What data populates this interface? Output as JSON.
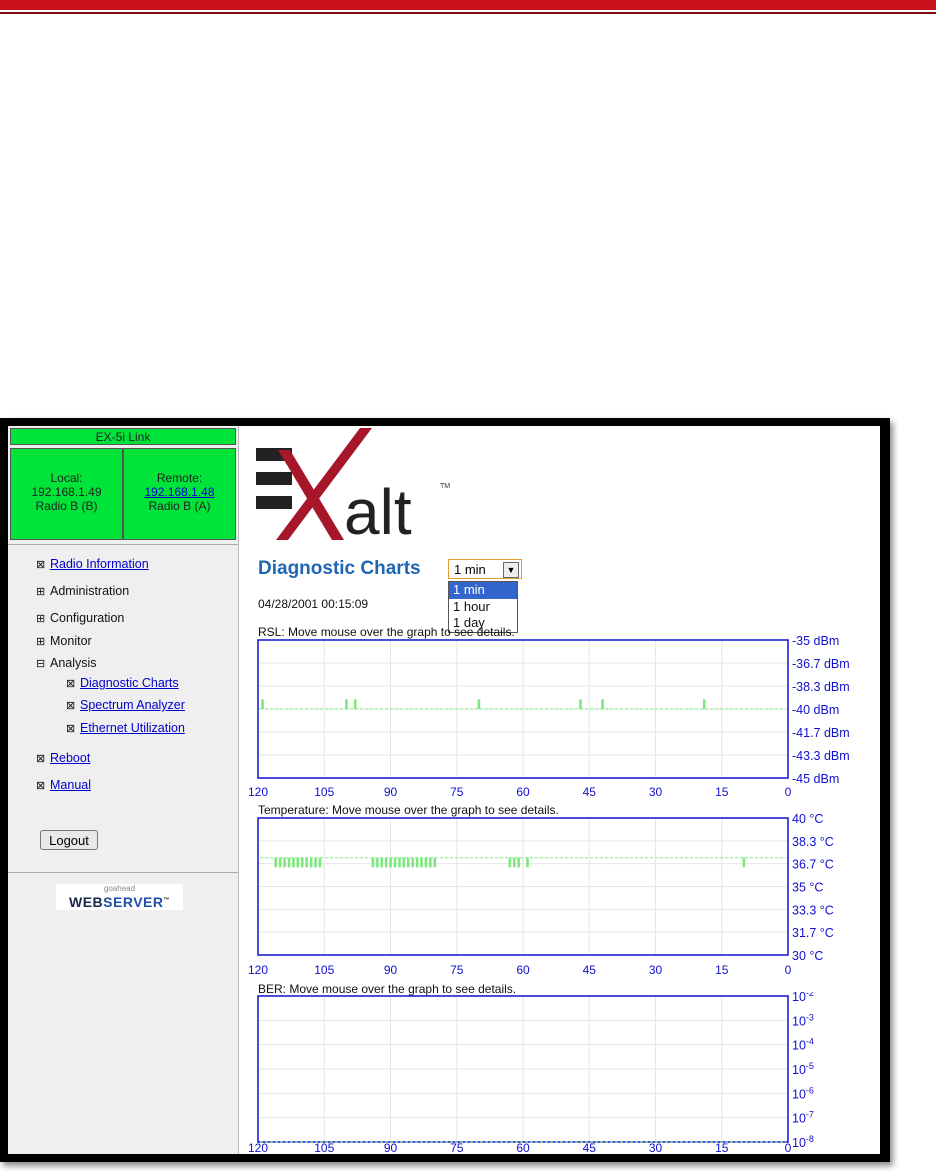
{
  "colors": {
    "accent_red": "#c9121c",
    "status_green": "#00e43a",
    "chart_blue": "#1010d0",
    "trace_green": "#7ee87e",
    "title_blue": "#1f66b5"
  },
  "sidebar": {
    "link_title": "EX-5i Link",
    "local": {
      "label": "Local:",
      "ip": "192.168.1.49",
      "radio": "Radio B (B)"
    },
    "remote": {
      "label": "Remote:",
      "ip": "192.168.1.48",
      "radio": "Radio B (A)"
    },
    "nav": [
      {
        "icon": "⊠",
        "label": "Radio Information",
        "link": true
      },
      {
        "icon": "⊞",
        "label": "Administration",
        "link": false
      },
      {
        "icon": "⊞",
        "label": "Configuration",
        "link": false
      },
      {
        "icon": "⊞",
        "label": "Monitor",
        "link": false
      },
      {
        "icon": "⊟",
        "label": "Analysis",
        "link": false
      },
      {
        "icon": "⊠",
        "label": "Diagnostic Charts",
        "link": true
      },
      {
        "icon": "⊠",
        "label": "Spectrum Analyzer",
        "link": true
      },
      {
        "icon": "⊠",
        "label": "Ethernet Utilization",
        "link": true
      },
      {
        "icon": "⊠",
        "label": "Reboot",
        "link": true
      },
      {
        "icon": "⊠",
        "label": "Manual",
        "link": true
      }
    ],
    "logout_label": "Logout",
    "webserver": {
      "small": "goahead",
      "web": "WEB",
      "server": "SERVER",
      "tm": "™"
    }
  },
  "logo": {
    "text": "alt",
    "tm": "TM"
  },
  "main": {
    "title": "Diagnostic Charts",
    "period_select": {
      "value": "1 min",
      "options": [
        "1 min",
        "1 hour",
        "1 day"
      ],
      "selected": "1 min"
    },
    "timestamp": "04/28/2001 00:15:09"
  },
  "chart_data": [
    {
      "type": "line",
      "title": "RSL: Move mouse over the graph to see details.",
      "x_ticks": [
        120,
        105,
        90,
        75,
        60,
        45,
        30,
        15,
        0
      ],
      "xlim": [
        120,
        0
      ],
      "y_ticks": [
        "-35 dBm",
        "-36.7 dBm",
        "-38.3 dBm",
        "-40 dBm",
        "-41.7 dBm",
        "-43.3 dBm",
        "-45 dBm"
      ],
      "ylim": [
        -45,
        -35
      ],
      "baseline": -40,
      "spikes": [
        {
          "x": 119,
          "y": -39.3
        },
        {
          "x": 100,
          "y": -39.3
        },
        {
          "x": 98,
          "y": -39.3
        },
        {
          "x": 70,
          "y": -39.3
        },
        {
          "x": 47,
          "y": -39.3
        },
        {
          "x": 42,
          "y": -39.3
        },
        {
          "x": 19,
          "y": -39.3
        }
      ],
      "grid": true
    },
    {
      "type": "line",
      "title": "Temperature: Move mouse over the graph to see details.",
      "x_ticks": [
        120,
        105,
        90,
        75,
        60,
        45,
        30,
        15,
        0
      ],
      "xlim": [
        120,
        0
      ],
      "y_ticks": [
        "40 °C",
        "38.3 °C",
        "36.7 °C",
        "35 °C",
        "33.3 °C",
        "31.7 °C",
        "30 °C"
      ],
      "ylim": [
        30,
        40
      ],
      "baseline": 37.1,
      "spikes": [
        {
          "x": 116,
          "y": 36.4
        },
        {
          "x": 115,
          "y": 36.4
        },
        {
          "x": 114,
          "y": 36.4
        },
        {
          "x": 113,
          "y": 36.4
        },
        {
          "x": 112,
          "y": 36.4
        },
        {
          "x": 111,
          "y": 36.4
        },
        {
          "x": 110,
          "y": 36.4
        },
        {
          "x": 109,
          "y": 36.4
        },
        {
          "x": 108,
          "y": 36.4
        },
        {
          "x": 107,
          "y": 36.4
        },
        {
          "x": 106,
          "y": 36.4
        },
        {
          "x": 94,
          "y": 36.4
        },
        {
          "x": 93,
          "y": 36.4
        },
        {
          "x": 92,
          "y": 36.4
        },
        {
          "x": 91,
          "y": 36.4
        },
        {
          "x": 90,
          "y": 36.4
        },
        {
          "x": 89,
          "y": 36.4
        },
        {
          "x": 88,
          "y": 36.4
        },
        {
          "x": 87,
          "y": 36.4
        },
        {
          "x": 86,
          "y": 36.4
        },
        {
          "x": 85,
          "y": 36.4
        },
        {
          "x": 84,
          "y": 36.4
        },
        {
          "x": 83,
          "y": 36.4
        },
        {
          "x": 82,
          "y": 36.4
        },
        {
          "x": 81,
          "y": 36.4
        },
        {
          "x": 80,
          "y": 36.4
        },
        {
          "x": 63,
          "y": 36.4
        },
        {
          "x": 62,
          "y": 36.4
        },
        {
          "x": 61,
          "y": 36.4
        },
        {
          "x": 59,
          "y": 36.4
        },
        {
          "x": 10,
          "y": 36.4
        }
      ],
      "grid": true
    },
    {
      "type": "line",
      "title": "BER: Move mouse over the graph to see details.",
      "x_ticks": [
        120,
        105,
        90,
        75,
        60,
        45,
        30,
        15,
        0
      ],
      "xlim": [
        120,
        0
      ],
      "y_ticks": [
        {
          "base": "10",
          "exp": "-2"
        },
        {
          "base": "10",
          "exp": "-3"
        },
        {
          "base": "10",
          "exp": "-4"
        },
        {
          "base": "10",
          "exp": "-5"
        },
        {
          "base": "10",
          "exp": "-6"
        },
        {
          "base": "10",
          "exp": "-7"
        },
        {
          "base": "10",
          "exp": "-8"
        }
      ],
      "ylim": [
        -8,
        -2
      ],
      "scale": "log",
      "baseline": -8,
      "spikes": [],
      "grid": true
    }
  ]
}
